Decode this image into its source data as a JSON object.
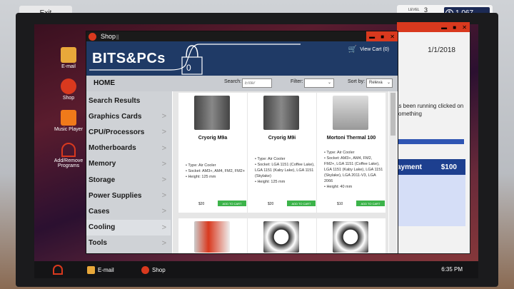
{
  "hud": {
    "exit_label": "Exit",
    "level_label": "LEVEL",
    "level_value": "3",
    "level_progress": 0.55,
    "money_symbol": "$",
    "money": "1,067"
  },
  "desktop": {
    "icons": [
      {
        "label": "E-mail",
        "icon": "email-icon"
      },
      {
        "label": "Shop",
        "icon": "shop-icon"
      },
      {
        "label": "Music Player",
        "icon": "music-icon"
      },
      {
        "label": "Add/Remove Programs",
        "icon": "programs-icon"
      }
    ]
  },
  "taskbar": {
    "items": [
      {
        "label": "E-mail"
      },
      {
        "label": "Shop"
      }
    ],
    "clock": "6:35 PM"
  },
  "back_window": {
    "date": "1/1/2018",
    "text": "as been running clicked on something",
    "payment_label": "ayment",
    "payment_amount": "$100"
  },
  "shop": {
    "title": "Shop",
    "title_suffix": "||",
    "brand": "BITS&PCs",
    "bag_count": "0",
    "cart_label": "View Cart (0)",
    "home_label": "HOME",
    "search_label": "Search:",
    "search_placeholder": "Enter",
    "filter_label": "Filter:",
    "sort_label": "Sort by:",
    "sort_value": "Releva",
    "categories": [
      "Search Results",
      "Graphics Cards",
      "CPU/Processors",
      "Motherboards",
      "Memory",
      "Storage",
      "Power Supplies",
      "Cases",
      "Cooling",
      "Tools"
    ],
    "active_category": "Cooling",
    "products": [
      {
        "name": "Cryorig M9a",
        "specs": [
          "• Type: Air Cooler",
          "• Socket: AM3+, AM4, FM2, FM2+",
          "• Height: 125 mm"
        ],
        "price": "$20",
        "add_label": "ADD TO CART"
      },
      {
        "name": "Cryorig M9i",
        "specs": [
          "• Type: Air Cooler",
          "• Socket: LGA 1151 (Coffee Lake), LGA 1151 (Kaby Lake), LGA 1151 (Skylake)",
          "• Height: 125 mm"
        ],
        "price": "$20",
        "add_label": "ADD TO CART"
      },
      {
        "name": "Mortoni Thermal 100",
        "specs": [
          "• Type: Air Cooler",
          "• Socket: AM3+, AM4, FM2, FM2+, LGA 1151 (Coffee Lake), LGA 1151 (Kaby Lake), LGA 1151 (Skylake), LGA 2011-V3, LGA 2066",
          "• Height: 40 mm"
        ],
        "price": "$10",
        "add_label": "ADD TO CART"
      }
    ]
  },
  "colors": {
    "shop_header": "#1f3a66",
    "window_red": "#d9391e",
    "add_green": "#3cb34a"
  }
}
